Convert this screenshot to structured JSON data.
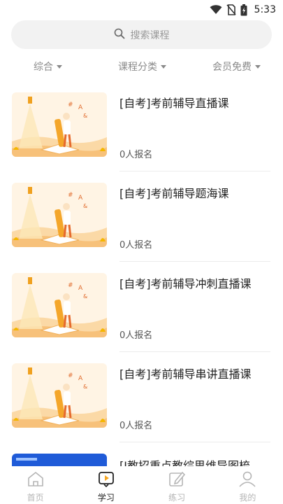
{
  "status_bar": {
    "time": "5:33",
    "icons": [
      "wifi-icon",
      "no-sim-icon",
      "battery-charging-icon"
    ]
  },
  "search": {
    "placeholder": "搜索课程",
    "icon": "search-icon"
  },
  "filters": [
    {
      "label": "综合"
    },
    {
      "label": "课程分类"
    },
    {
      "label": "会员免费"
    }
  ],
  "courses": [
    {
      "title": "[自考]考前辅导直播课",
      "enroll": "0人报名"
    },
    {
      "title": "[自考]考前辅导题海课",
      "enroll": "0人报名"
    },
    {
      "title": "[自考]考前辅导冲刺直播课",
      "enroll": "0人报名"
    },
    {
      "title": "[自考]考前辅导串讲直播课",
      "enroll": "0人报名"
    },
    {
      "title": "[J教招重点教综思维导图梳",
      "enroll": ""
    }
  ],
  "tabbar": [
    {
      "label": "首页",
      "icon": "home-icon",
      "active": false
    },
    {
      "label": "学习",
      "icon": "study-play-icon",
      "active": true
    },
    {
      "label": "练习",
      "icon": "edit-icon",
      "active": false
    },
    {
      "label": "我的",
      "icon": "profile-icon",
      "active": false
    }
  ],
  "colors": {
    "accent": "#f5a623",
    "thumb_bg": "#fde9cc",
    "thumb_blue": "#1f5bd8"
  }
}
